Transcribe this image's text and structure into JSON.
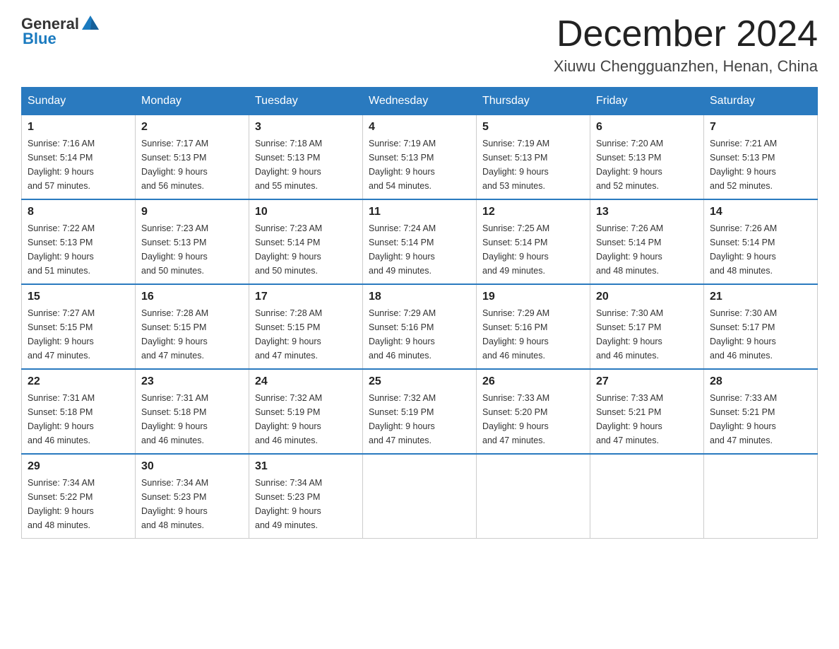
{
  "header": {
    "logo_general": "General",
    "logo_blue": "Blue",
    "month_title": "December 2024",
    "location": "Xiuwu Chengguanzhen, Henan, China"
  },
  "days_of_week": [
    "Sunday",
    "Monday",
    "Tuesday",
    "Wednesday",
    "Thursday",
    "Friday",
    "Saturday"
  ],
  "weeks": [
    [
      {
        "day": "1",
        "sunrise": "7:16 AM",
        "sunset": "5:14 PM",
        "daylight": "9 hours and 57 minutes."
      },
      {
        "day": "2",
        "sunrise": "7:17 AM",
        "sunset": "5:13 PM",
        "daylight": "9 hours and 56 minutes."
      },
      {
        "day": "3",
        "sunrise": "7:18 AM",
        "sunset": "5:13 PM",
        "daylight": "9 hours and 55 minutes."
      },
      {
        "day": "4",
        "sunrise": "7:19 AM",
        "sunset": "5:13 PM",
        "daylight": "9 hours and 54 minutes."
      },
      {
        "day": "5",
        "sunrise": "7:19 AM",
        "sunset": "5:13 PM",
        "daylight": "9 hours and 53 minutes."
      },
      {
        "day": "6",
        "sunrise": "7:20 AM",
        "sunset": "5:13 PM",
        "daylight": "9 hours and 52 minutes."
      },
      {
        "day": "7",
        "sunrise": "7:21 AM",
        "sunset": "5:13 PM",
        "daylight": "9 hours and 52 minutes."
      }
    ],
    [
      {
        "day": "8",
        "sunrise": "7:22 AM",
        "sunset": "5:13 PM",
        "daylight": "9 hours and 51 minutes."
      },
      {
        "day": "9",
        "sunrise": "7:23 AM",
        "sunset": "5:13 PM",
        "daylight": "9 hours and 50 minutes."
      },
      {
        "day": "10",
        "sunrise": "7:23 AM",
        "sunset": "5:14 PM",
        "daylight": "9 hours and 50 minutes."
      },
      {
        "day": "11",
        "sunrise": "7:24 AM",
        "sunset": "5:14 PM",
        "daylight": "9 hours and 49 minutes."
      },
      {
        "day": "12",
        "sunrise": "7:25 AM",
        "sunset": "5:14 PM",
        "daylight": "9 hours and 49 minutes."
      },
      {
        "day": "13",
        "sunrise": "7:26 AM",
        "sunset": "5:14 PM",
        "daylight": "9 hours and 48 minutes."
      },
      {
        "day": "14",
        "sunrise": "7:26 AM",
        "sunset": "5:14 PM",
        "daylight": "9 hours and 48 minutes."
      }
    ],
    [
      {
        "day": "15",
        "sunrise": "7:27 AM",
        "sunset": "5:15 PM",
        "daylight": "9 hours and 47 minutes."
      },
      {
        "day": "16",
        "sunrise": "7:28 AM",
        "sunset": "5:15 PM",
        "daylight": "9 hours and 47 minutes."
      },
      {
        "day": "17",
        "sunrise": "7:28 AM",
        "sunset": "5:15 PM",
        "daylight": "9 hours and 47 minutes."
      },
      {
        "day": "18",
        "sunrise": "7:29 AM",
        "sunset": "5:16 PM",
        "daylight": "9 hours and 46 minutes."
      },
      {
        "day": "19",
        "sunrise": "7:29 AM",
        "sunset": "5:16 PM",
        "daylight": "9 hours and 46 minutes."
      },
      {
        "day": "20",
        "sunrise": "7:30 AM",
        "sunset": "5:17 PM",
        "daylight": "9 hours and 46 minutes."
      },
      {
        "day": "21",
        "sunrise": "7:30 AM",
        "sunset": "5:17 PM",
        "daylight": "9 hours and 46 minutes."
      }
    ],
    [
      {
        "day": "22",
        "sunrise": "7:31 AM",
        "sunset": "5:18 PM",
        "daylight": "9 hours and 46 minutes."
      },
      {
        "day": "23",
        "sunrise": "7:31 AM",
        "sunset": "5:18 PM",
        "daylight": "9 hours and 46 minutes."
      },
      {
        "day": "24",
        "sunrise": "7:32 AM",
        "sunset": "5:19 PM",
        "daylight": "9 hours and 46 minutes."
      },
      {
        "day": "25",
        "sunrise": "7:32 AM",
        "sunset": "5:19 PM",
        "daylight": "9 hours and 47 minutes."
      },
      {
        "day": "26",
        "sunrise": "7:33 AM",
        "sunset": "5:20 PM",
        "daylight": "9 hours and 47 minutes."
      },
      {
        "day": "27",
        "sunrise": "7:33 AM",
        "sunset": "5:21 PM",
        "daylight": "9 hours and 47 minutes."
      },
      {
        "day": "28",
        "sunrise": "7:33 AM",
        "sunset": "5:21 PM",
        "daylight": "9 hours and 47 minutes."
      }
    ],
    [
      {
        "day": "29",
        "sunrise": "7:34 AM",
        "sunset": "5:22 PM",
        "daylight": "9 hours and 48 minutes."
      },
      {
        "day": "30",
        "sunrise": "7:34 AM",
        "sunset": "5:23 PM",
        "daylight": "9 hours and 48 minutes."
      },
      {
        "day": "31",
        "sunrise": "7:34 AM",
        "sunset": "5:23 PM",
        "daylight": "9 hours and 49 minutes."
      },
      null,
      null,
      null,
      null
    ]
  ],
  "labels": {
    "sunrise": "Sunrise:",
    "sunset": "Sunset:",
    "daylight": "Daylight:"
  }
}
